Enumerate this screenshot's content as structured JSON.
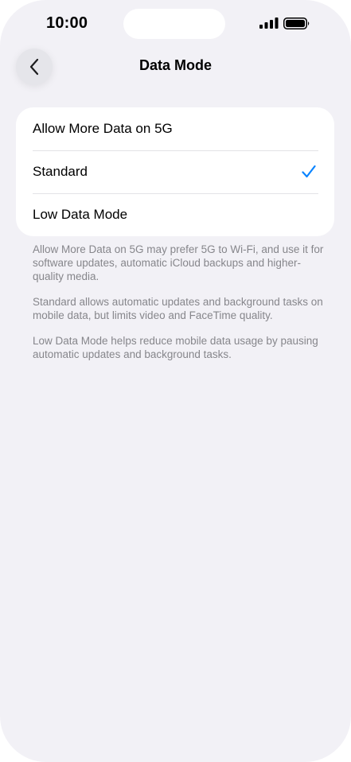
{
  "status_bar": {
    "time": "10:00"
  },
  "nav": {
    "title": "Data Mode",
    "back_icon": "chevron-left-icon"
  },
  "options": [
    {
      "label": "Allow More Data on 5G",
      "selected": false
    },
    {
      "label": "Standard",
      "selected": true
    },
    {
      "label": "Low Data Mode",
      "selected": false
    }
  ],
  "footnotes": [
    "Allow More Data on 5G may prefer 5G to Wi-Fi, and use it for software updates, automatic iCloud backups and higher-quality media.",
    "Standard allows automatic updates and background tasks on mobile data, but limits video and FaceTime quality.",
    "Low Data Mode helps reduce mobile data usage by pausing automatic updates and background tasks."
  ],
  "colors": {
    "accent": "#0a84ff",
    "background": "#f2f1f6",
    "card": "#ffffff",
    "secondary_text": "#86868b"
  }
}
